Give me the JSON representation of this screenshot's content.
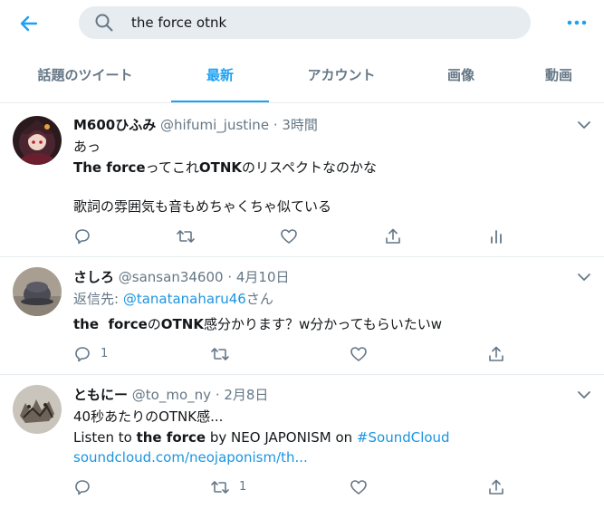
{
  "search": {
    "query": "the force otnk"
  },
  "tabs": [
    {
      "label": "話題のツイート"
    },
    {
      "label": "最新"
    },
    {
      "label": "アカウント"
    },
    {
      "label": "画像"
    },
    {
      "label": "動画"
    }
  ],
  "tweets": [
    {
      "name": "M600ひふみ",
      "handle": "@hifumi_justine",
      "time": "· 3時間",
      "line1": "あっ",
      "line2_b1": "The force",
      "line2_t1": "ってこれ",
      "line2_b2": "OTNK",
      "line2_t2": "のリスペクトなのかな",
      "line3": "歌詞の雰囲気も音もめちゃくちゃ似ている"
    },
    {
      "name": "さしろ",
      "handle": "@sansan34600",
      "time": "· 4月10日",
      "reply_prefix": "返信先: ",
      "reply_handle": "@tanatanaharu46",
      "reply_suffix": "さん",
      "body_b1": "the  force",
      "body_t1": "の",
      "body_b2": "OTNK",
      "body_t2": "感分かります？w分かってもらいたいw",
      "reply_count": "1"
    },
    {
      "name": "ともにー",
      "handle": "@to_mo_ny",
      "time": "· 2月8日",
      "line1": "40秒あたりのOTNK感...",
      "line2_t1": "Listen to ",
      "line2_b1": "the force",
      "line2_t2": " by NEO JAPONISM on ",
      "line2_tag": "#SoundCloud",
      "link": "soundcloud.com/neojaponism/th...",
      "retweet_count": "1"
    }
  ],
  "colors": {
    "accent": "#1da1f2",
    "muted": "#657786",
    "text": "#14171a",
    "border": "#e6ecf0"
  }
}
